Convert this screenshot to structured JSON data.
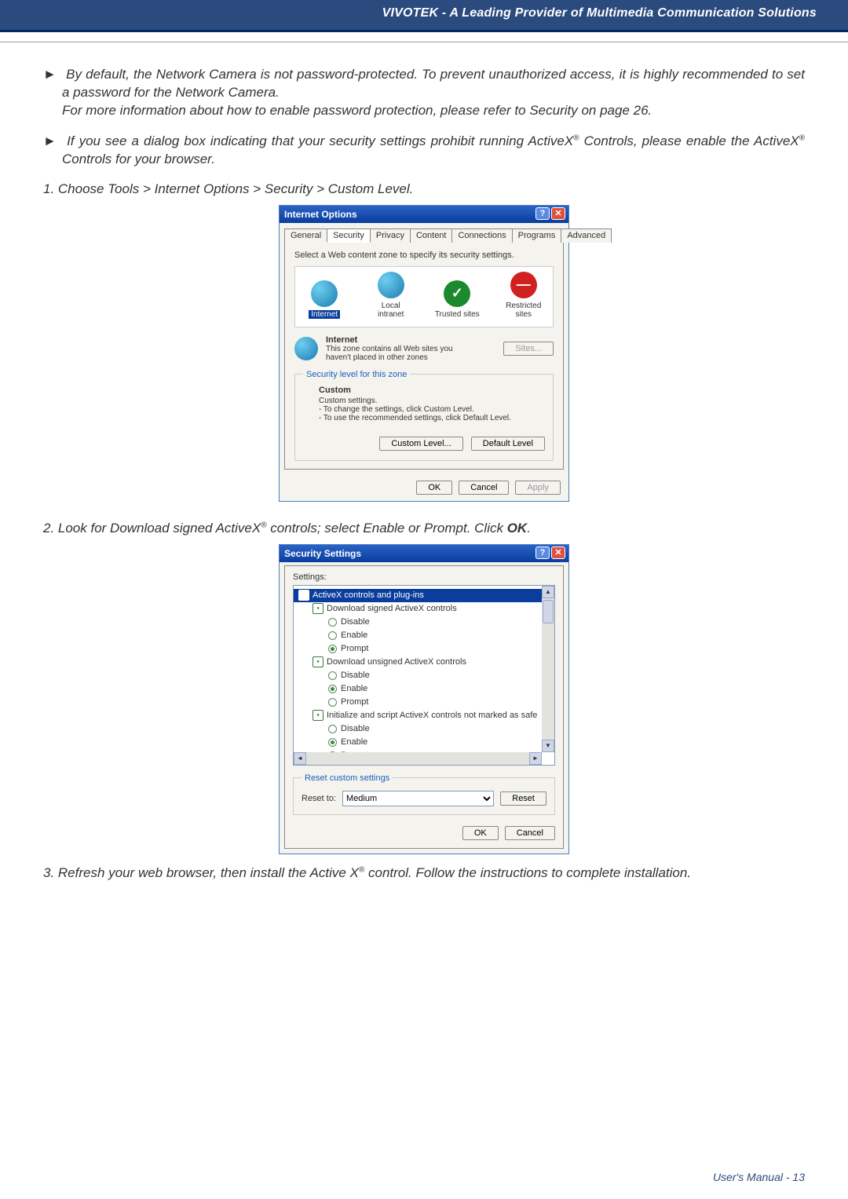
{
  "header": {
    "title": "VIVOTEK - A Leading Provider of Multimedia Communication Solutions"
  },
  "paragraphs": {
    "p1_before": "By default, the Network Camera is not password-protected. To prevent unauthorized access, it is highly recommended to set a password for the Network Camera.",
    "p1_after": "For more information about how to enable password protection, please refer to Security on page 26.",
    "p2_before": "If you see a dialog box indicating that your security settings prohibit running ActiveX",
    "p2_after": " Controls, please enable the ActiveX",
    "p2_tail": " Controls for your browser.",
    "reg": "®"
  },
  "steps": {
    "s1": "1. Choose Tools > Internet Options > Security > Custom Level.",
    "s2a": "2. Look for Download signed ActiveX",
    "s2b": " controls; select Enable or Prompt. Click ",
    "s2c": "OK",
    "s2d": ".",
    "s3a": "3. Refresh your web browser, then install the Active X",
    "s3b": " control. Follow the instructions to complete installation."
  },
  "io": {
    "title": "Internet Options",
    "tabs": [
      "General",
      "Security",
      "Privacy",
      "Content",
      "Connections",
      "Programs",
      "Advanced"
    ],
    "zone_instr": "Select a Web content zone to specify its security settings.",
    "zones": {
      "internet": "Internet",
      "local": "Local intranet",
      "trusted": "Trusted sites",
      "restricted": "Restricted sites"
    },
    "zone_desc_title": "Internet",
    "zone_desc_1": "This zone contains all Web sites you",
    "zone_desc_2": "haven't placed in other zones",
    "sites_btn": "Sites...",
    "sec_legend": "Security level for this zone",
    "custom_title": "Custom",
    "custom_sub0": "Custom settings.",
    "custom_sub1": "- To change the settings, click Custom Level.",
    "custom_sub2": "- To use the recommended settings, click Default Level.",
    "btn_custom": "Custom Level...",
    "btn_default": "Default Level",
    "btn_ok": "OK",
    "btn_cancel": "Cancel",
    "btn_apply": "Apply"
  },
  "ss": {
    "title": "Security Settings",
    "settings_label": "Settings:",
    "tree": {
      "root": "ActiveX controls and plug-ins",
      "g1": "Download signed ActiveX controls",
      "g2": "Download unsigned ActiveX controls",
      "g3": "Initialize and script ActiveX controls not marked as safe",
      "disable": "Disable",
      "enable": "Enable",
      "prompt": "Prompt"
    },
    "reset_legend": "Reset custom settings",
    "reset_to": "Reset to:",
    "reset_val": "Medium",
    "btn_reset": "Reset",
    "btn_ok": "OK",
    "btn_cancel": "Cancel"
  },
  "footer": {
    "text": "User's Manual - 13"
  }
}
